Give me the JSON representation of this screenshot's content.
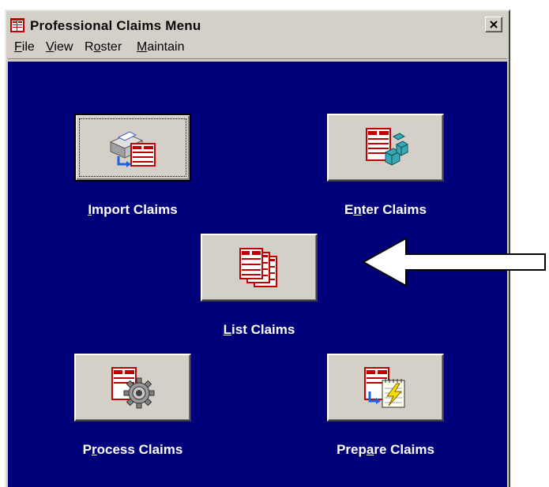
{
  "window": {
    "title": "Professional Claims Menu",
    "close_label": "×"
  },
  "menubar": {
    "items": [
      {
        "label": "File",
        "mnemonic": "F"
      },
      {
        "label": "View",
        "mnemonic": "V"
      },
      {
        "label": "Roster",
        "mnemonic": "o"
      },
      {
        "label": "Maintain",
        "mnemonic": "M"
      }
    ]
  },
  "buttons": {
    "import": {
      "label": "Import Claims",
      "icon": "printer-claim-icon"
    },
    "enter": {
      "label": "Enter Claims",
      "icon": "claim-cubes-icon"
    },
    "list": {
      "label": "List Claims",
      "icon": "stacked-claims-icon"
    },
    "process": {
      "label": "Process Claims",
      "icon": "claim-gear-icon"
    },
    "prepare": {
      "label": "Prepare Claims",
      "icon": "claim-notepad-icon"
    }
  },
  "colors": {
    "client_bg": "#00007b",
    "chrome": "#d4d0c8",
    "form_red": "#c00000",
    "arrow_fill": "#ffffff"
  }
}
